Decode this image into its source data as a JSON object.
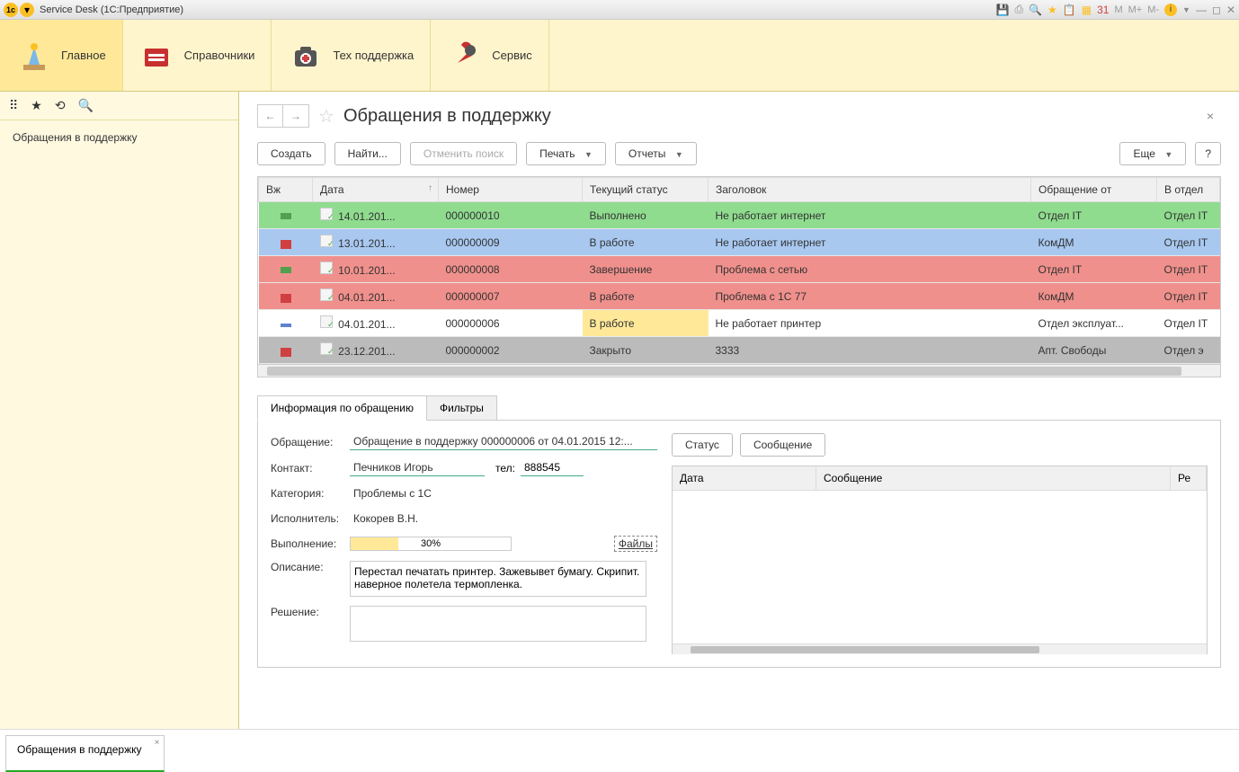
{
  "titlebar": {
    "title": "Service Desk  (1С:Предприятие)",
    "m_buttons": [
      "M",
      "M+",
      "M-"
    ]
  },
  "ribbon": {
    "items": [
      {
        "label": "Главное"
      },
      {
        "label": "Справочники"
      },
      {
        "label": "Тех поддержка"
      },
      {
        "label": "Сервис"
      }
    ]
  },
  "sidebar": {
    "link": "Обращения в поддержку"
  },
  "page": {
    "title": "Обращения в поддержку"
  },
  "actions": {
    "create": "Создать",
    "find": "Найти...",
    "cancel_search": "Отменить поиск",
    "print": "Печать",
    "reports": "Отчеты",
    "more": "Еще",
    "help": "?"
  },
  "table": {
    "headers": {
      "priority": "Вж",
      "date": "Дата",
      "number": "Номер",
      "status": "Текущий статус",
      "title": "Заголовок",
      "from": "Обращение от",
      "to_dept": "В отдел"
    },
    "rows": [
      {
        "cls": "row-green",
        "pr": "pr-green",
        "date": "14.01.201...",
        "num": "000000010",
        "status": "Выполнено",
        "status_yellow": false,
        "title": "Не работает интернет",
        "from": "Отдел IT",
        "dept": "Отдел IT"
      },
      {
        "cls": "row-blue",
        "pr": "pr-red",
        "date": "13.01.201...",
        "num": "000000009",
        "status": "В работе",
        "status_yellow": false,
        "title": "Не работает интернет",
        "from": "КомДМ",
        "dept": "Отдел IT"
      },
      {
        "cls": "row-red",
        "pr": "pr-green",
        "date": "10.01.201...",
        "num": "000000008",
        "status": "Завершение",
        "status_yellow": false,
        "title": "Проблема с сетью",
        "from": "Отдел IT",
        "dept": "Отдел IT"
      },
      {
        "cls": "row-red",
        "pr": "pr-red",
        "date": "04.01.201...",
        "num": "000000007",
        "status": "В работе",
        "status_yellow": false,
        "title": "Проблема с  1С 77",
        "from": "КомДМ",
        "dept": "Отдел IT"
      },
      {
        "cls": "row-white",
        "pr": "pr-blue",
        "date": "04.01.201...",
        "num": "000000006",
        "status": "В работе",
        "status_yellow": true,
        "title": "Не работает принтер",
        "from": "Отдел эксплуат...",
        "dept": "Отдел IT"
      },
      {
        "cls": "row-grey",
        "pr": "pr-red",
        "date": "23.12.201...",
        "num": "000000002",
        "status": "Закрыто",
        "status_yellow": false,
        "title": "3333",
        "from": "Апт. Свободы",
        "dept": "Отдел э"
      }
    ]
  },
  "detail": {
    "tabs": {
      "info": "Информация по обращению",
      "filters": "Фильтры"
    },
    "labels": {
      "ticket": "Обращение:",
      "contact": "Контакт:",
      "tel": "тел:",
      "category": "Категория:",
      "executor": "Исполнитель:",
      "progress": "Выполнение:",
      "files": "Файлы",
      "description": "Описание:",
      "resolution": "Решение:"
    },
    "ticket": "Обращение в поддержку 000000006 от 04.01.2015 12:...",
    "contact": "Печников Игорь",
    "tel": "888545",
    "category": "Проблемы с 1С",
    "executor": "Кокорев В.Н.",
    "progress_pct": "30%",
    "progress_width": "30%",
    "description": "Перестал печатать принтер. Зажевывет бумагу. Скрипит. наверное полетела термопленка.",
    "resolution": "",
    "buttons": {
      "status": "Статус",
      "message": "Сообщение"
    },
    "msg_headers": {
      "date": "Дата",
      "msg": "Сообщение",
      "re": "Ре"
    }
  },
  "bottom": {
    "tab": "Обращения в поддержку"
  }
}
